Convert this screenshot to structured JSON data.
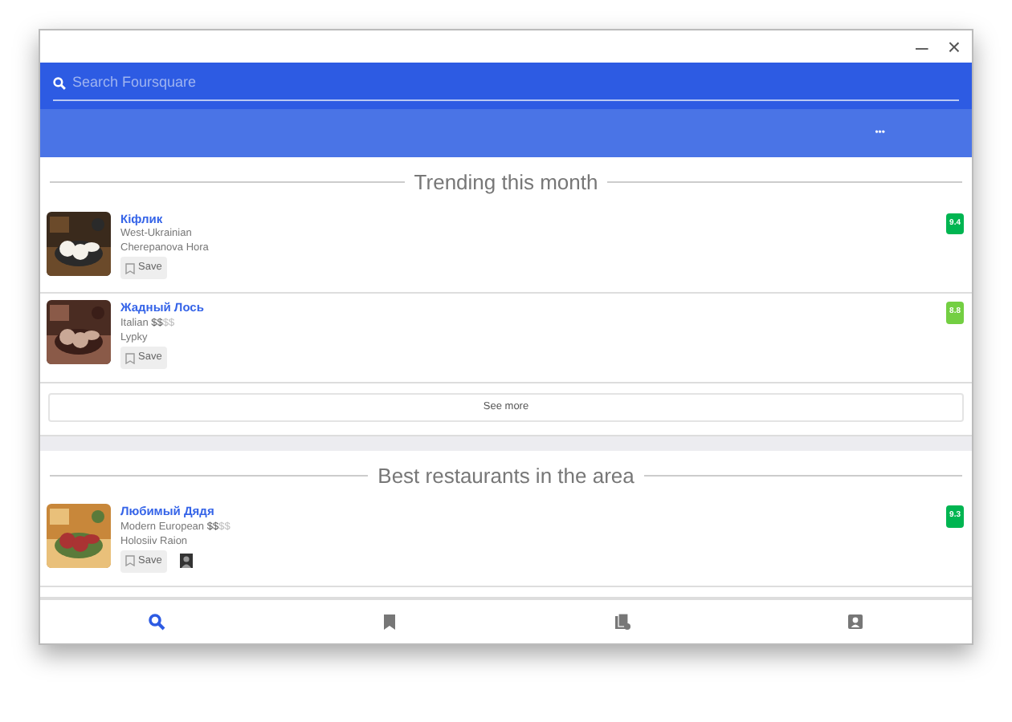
{
  "window": {
    "minimize": "–",
    "close": "×"
  },
  "search": {
    "placeholder": "Search Foursquare"
  },
  "toolbar": {
    "more": "•••"
  },
  "sections": [
    {
      "title": "Trending this month",
      "see_more": "See more",
      "venues": [
        {
          "name": "Кіфлик",
          "category": "West-Ukrainian",
          "area": "Cherepanova Hora",
          "save": "Save",
          "score": "9.4",
          "color": "#00b551",
          "friend": false
        },
        {
          "name": "Жадный Лось",
          "category": "Italian",
          "price_active": "$$",
          "price_rest": "$$",
          "area": "Lypky",
          "save": "Save",
          "score": "8.8",
          "color": "#73cf42",
          "friend": false
        }
      ]
    },
    {
      "title": "Best restaurants in the area",
      "venues": [
        {
          "name": "Любимый Дядя",
          "category": "Modern European",
          "price_active": "$$",
          "price_rest": "$$",
          "area": "Holosiiv Raion",
          "save": "Save",
          "score": "9.3",
          "color": "#00b551",
          "friend": true
        }
      ]
    }
  ],
  "bottom_nav": [
    {
      "kind": "search",
      "selected": true
    },
    {
      "kind": "saved",
      "selected": false
    },
    {
      "kind": "lists",
      "selected": false
    },
    {
      "kind": "profile",
      "selected": false
    }
  ]
}
